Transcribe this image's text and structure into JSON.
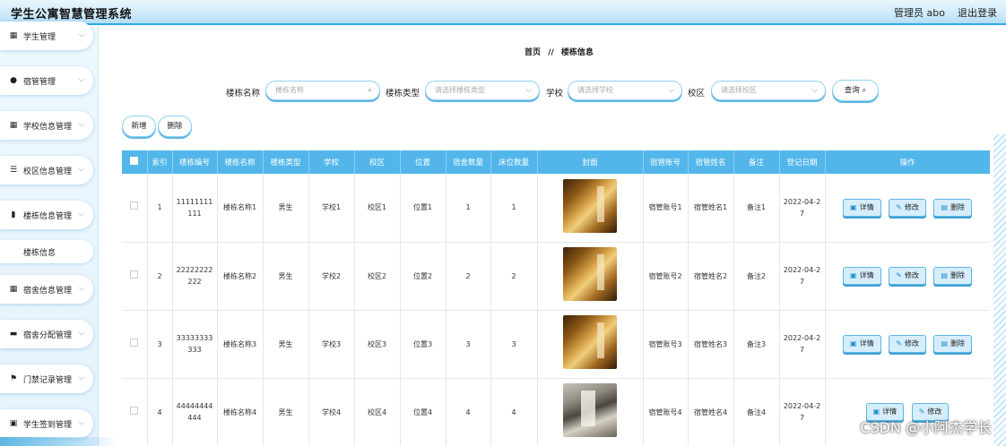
{
  "header": {
    "title": "学生公寓智慧管理系统",
    "user": "管理员 abo",
    "logout": "退出登录"
  },
  "sidebar": {
    "items": [
      {
        "label": "学生管理",
        "icon": "grid-icon"
      },
      {
        "label": "宿管管理",
        "icon": "user-icon"
      },
      {
        "label": "学校信息管理",
        "icon": "grid-icon"
      },
      {
        "label": "校区信息管理",
        "icon": "sliders-icon"
      },
      {
        "label": "楼栋信息管理",
        "icon": "bar-chart-icon"
      },
      {
        "label": "宿舍信息管理",
        "icon": "grid-icon"
      },
      {
        "label": "宿舍分配管理",
        "icon": "message-icon"
      },
      {
        "label": "门禁记录管理",
        "icon": "flag-icon"
      },
      {
        "label": "学生签到管理",
        "icon": "clipboard-icon"
      }
    ],
    "subitem": "楼栋信息"
  },
  "breadcrumb": {
    "home": "首页",
    "sep": "//",
    "current": "楼栋信息"
  },
  "search": {
    "name_label": "楼栋名称",
    "name_placeholder": "楼栋名称",
    "type_label": "楼栋类型",
    "type_placeholder": "请选择楼栋类型",
    "school_label": "学校",
    "school_placeholder": "请选择学校",
    "campus_label": "校区",
    "campus_placeholder": "请选择校区",
    "query": "查询"
  },
  "actions": {
    "add": "新增",
    "delete": "删除"
  },
  "table": {
    "columns": [
      "索引",
      "楼栋编号",
      "楼栋名称",
      "楼栋类型",
      "学校",
      "校区",
      "位置",
      "宿舍数量",
      "床位数量",
      "封面",
      "宿管账号",
      "宿管姓名",
      "备注",
      "登记日期",
      "操作"
    ],
    "rows": [
      {
        "index": "1",
        "code": "11111111111",
        "name": "楼栋名称1",
        "type": "男生",
        "school": "学校1",
        "campus": "校区1",
        "location": "位置1",
        "rooms": "1",
        "beds": "1",
        "account": "宿管账号1",
        "manager": "宿管姓名1",
        "remark": "备注1",
        "date": "2022-04-27"
      },
      {
        "index": "2",
        "code": "22222222222",
        "name": "楼栋名称2",
        "type": "男生",
        "school": "学校2",
        "campus": "校区2",
        "location": "位置2",
        "rooms": "2",
        "beds": "2",
        "account": "宿管账号2",
        "manager": "宿管姓名2",
        "remark": "备注2",
        "date": "2022-04-27"
      },
      {
        "index": "3",
        "code": "33333333333",
        "name": "楼栋名称3",
        "type": "男生",
        "school": "学校3",
        "campus": "校区3",
        "location": "位置3",
        "rooms": "3",
        "beds": "3",
        "account": "宿管账号3",
        "manager": "宿管姓名3",
        "remark": "备注3",
        "date": "2022-04-27"
      },
      {
        "index": "4",
        "code": "44444444444",
        "name": "楼栋名称4",
        "type": "男生",
        "school": "学校4",
        "campus": "校区4",
        "location": "位置4",
        "rooms": "4",
        "beds": "4",
        "account": "宿管账号4",
        "manager": "宿管姓名4",
        "remark": "备注4",
        "date": "2022-04-27"
      }
    ],
    "ops": {
      "detail": "详情",
      "edit": "修改",
      "delete": "删除"
    }
  },
  "watermark": "CSDN @小阿杰学长"
}
